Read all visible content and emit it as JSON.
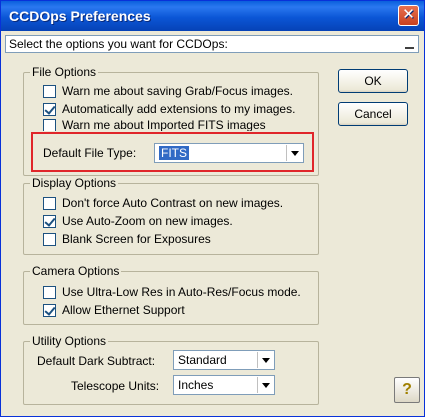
{
  "window": {
    "title": "CCDOps Preferences",
    "close_symbol": "✕"
  },
  "header": {
    "select_prompt": "Select the options you want for CCDOps:"
  },
  "buttons": {
    "ok": "OK",
    "cancel": "Cancel",
    "help_symbol": "?"
  },
  "file_options": {
    "title": "File Options",
    "items": [
      {
        "label": "Warn me about saving Grab/Focus images.",
        "checked": false
      },
      {
        "label": "Automatically add extensions to my images.",
        "checked": true
      },
      {
        "label": "Warn me about Imported FITS images",
        "checked": false
      }
    ],
    "default_file_type_label": "Default File Type:",
    "default_file_type_value": "FITS"
  },
  "display_options": {
    "title": "Display Options",
    "items": [
      {
        "label": "Don't force Auto Contrast on new images.",
        "checked": false
      },
      {
        "label": "Use Auto-Zoom on new images.",
        "checked": true
      },
      {
        "label": "Blank Screen for Exposures",
        "checked": false
      }
    ]
  },
  "camera_options": {
    "title": "Camera Options",
    "items": [
      {
        "label": "Use Ultra-Low Res in Auto-Res/Focus mode.",
        "checked": false
      },
      {
        "label": "Allow Ethernet Support",
        "checked": true
      }
    ]
  },
  "utility_options": {
    "title": "Utility Options",
    "dark_subtract_label": "Default Dark Subtract:",
    "dark_subtract_value": "Standard",
    "telescope_units_label": "Telescope Units:",
    "telescope_units_value": "Inches"
  },
  "colors": {
    "titlebar": "#0b56d6",
    "highlight_box": "#e0262a",
    "selection": "#316ac5",
    "dialog_bg": "#ece9d8"
  }
}
